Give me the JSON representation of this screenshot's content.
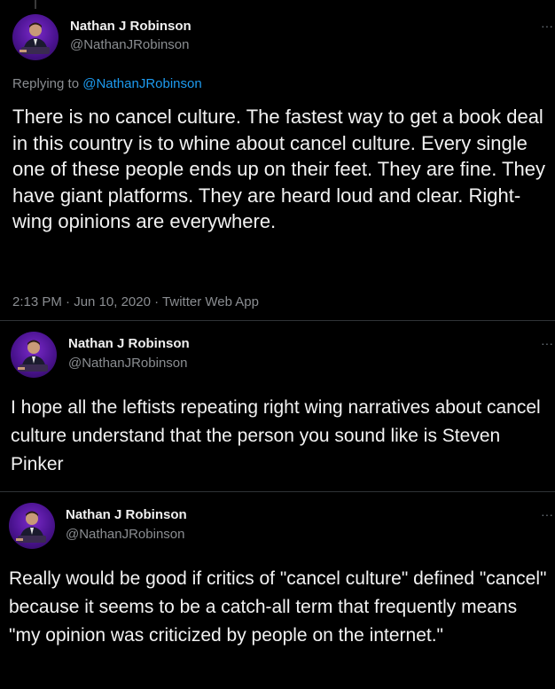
{
  "tweets": [
    {
      "author_name": "Nathan J Robinson",
      "author_handle": "@NathanJRobinson",
      "reply_prefix": "Replying to ",
      "reply_to": "@NathanJRobinson",
      "text": "There is no cancel culture. The fastest way to get a book deal in this country is to whine about cancel culture. Every single one of these people ends up on their feet. They are fine. They have giant platforms. They are heard loud and clear. Right-wing opinions are everywhere.",
      "time": "2:13 PM",
      "date": "Jun 10, 2020",
      "source": "Twitter Web App",
      "sep": "·",
      "more": "···"
    },
    {
      "author_name": "Nathan J Robinson",
      "author_handle": "@NathanJRobinson",
      "text": "I hope all the leftists repeating right wing narratives about cancel culture understand that the person you sound like is Steven Pinker",
      "more": "···"
    },
    {
      "author_name": "Nathan J Robinson",
      "author_handle": "@NathanJRobinson",
      "text": "Really would be good if critics of \"cancel culture\" defined \"cancel\" because it seems to be a catch-all term that frequently means \"my opinion was criticized by people on the internet.\"",
      "more": "···"
    }
  ],
  "colors": {
    "background": "#000000",
    "text": "#f2f2f2",
    "secondary": "#8a8d91",
    "link": "#1d9bf0",
    "avatar_bg": "#5a18a8"
  },
  "icons": [
    "avatar-photo",
    "more-options-icon"
  ]
}
